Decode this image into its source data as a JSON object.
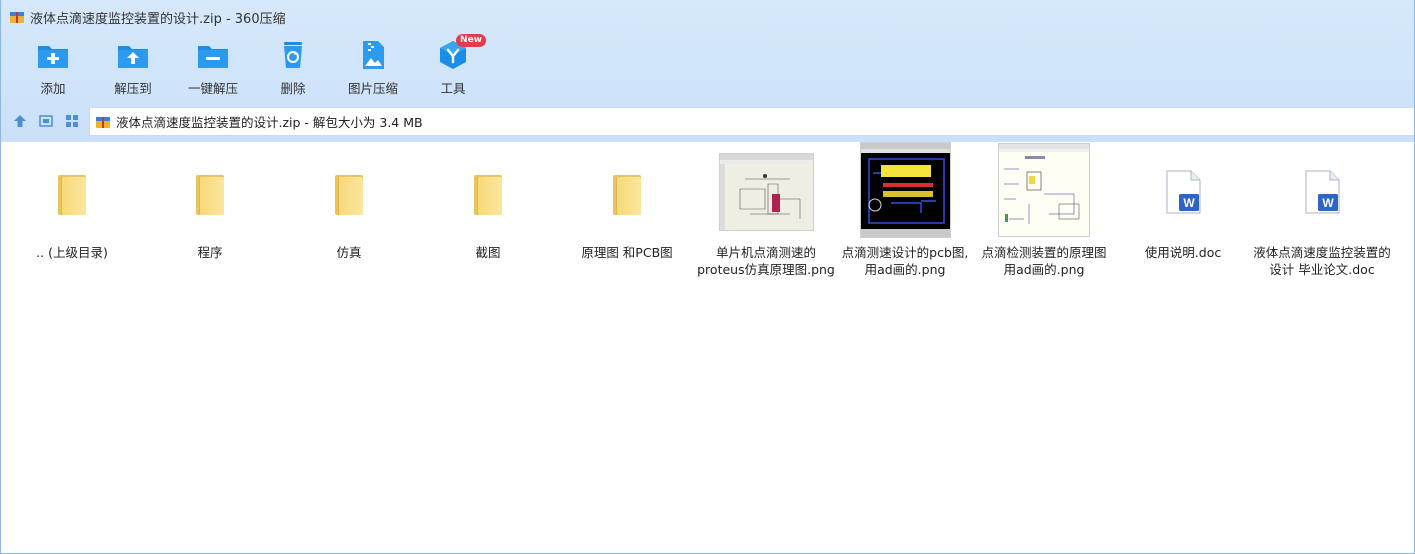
{
  "window": {
    "title": "液体点滴速度监控装置的设计.zip - 360压缩"
  },
  "toolbar": {
    "items": [
      {
        "label": "添加",
        "icon": "add-icon"
      },
      {
        "label": "解压到",
        "icon": "extract-to-icon"
      },
      {
        "label": "一键解压",
        "icon": "one-click-extract-icon"
      },
      {
        "label": "删除",
        "icon": "delete-icon"
      },
      {
        "label": "图片压缩",
        "icon": "image-compress-icon"
      },
      {
        "label": "工具",
        "icon": "tools-icon",
        "badge": "New"
      }
    ]
  },
  "navbar": {
    "path": "液体点滴速度监控装置的设计.zip - 解包大小为 3.4 MB"
  },
  "files": [
    {
      "name": ".. (上级目录)",
      "type": "parent-folder"
    },
    {
      "name": "程序",
      "type": "folder"
    },
    {
      "name": "仿真",
      "type": "folder"
    },
    {
      "name": "截图",
      "type": "folder"
    },
    {
      "name": "原理图 和PCB图",
      "type": "folder"
    },
    {
      "name_line1": "单片机点滴测速的",
      "name_line2": "proteus仿真原理图.png",
      "type": "image"
    },
    {
      "name_line1": "点滴测速设计的pcb图,",
      "name_line2": "用ad画的.png",
      "type": "image"
    },
    {
      "name_line1": "点滴检测装置的原理图",
      "name_line2": "用ad画的.png",
      "type": "image"
    },
    {
      "name": "使用说明.doc",
      "type": "doc"
    },
    {
      "name_line1": "液体点滴速度监控装置的",
      "name_line2": "设计 毕业论文.doc",
      "type": "doc"
    }
  ],
  "colors": {
    "accent": "#1a8ee6",
    "folder": "#f6d97a",
    "chrome": "#d6e8fb",
    "badge": "#e8394a"
  }
}
